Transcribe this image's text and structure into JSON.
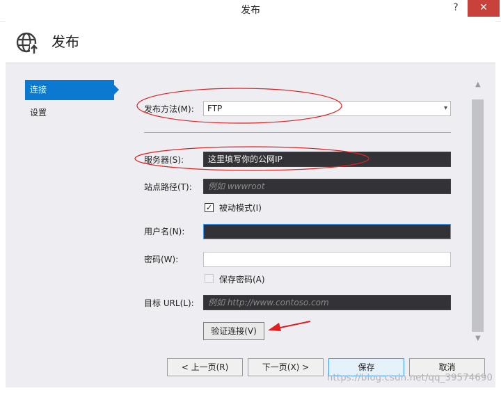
{
  "window": {
    "title": "发布",
    "help_glyph": "?",
    "close_glyph": "✕"
  },
  "header": {
    "title": "发布",
    "icon": "globe-publish-icon"
  },
  "nav": {
    "items": [
      {
        "label": "连接",
        "active": true
      },
      {
        "label": "设置",
        "active": false
      }
    ]
  },
  "form": {
    "method": {
      "label": "发布方法(M):",
      "value": "FTP"
    },
    "server": {
      "label": "服务器(S):",
      "value": "这里填写你的公网IP"
    },
    "site_path": {
      "label": "站点路径(T):",
      "placeholder": "例如 wwwroot"
    },
    "passive": {
      "label": "被动模式(I)",
      "checked": true
    },
    "username": {
      "label": "用户名(N):",
      "value": ""
    },
    "password": {
      "label": "密码(W):",
      "value": ""
    },
    "save_password": {
      "label": "保存密码(A)",
      "checked": false
    },
    "target_url": {
      "label": "目标 URL(L):",
      "placeholder": "例如 http://www.contoso.com"
    },
    "verify_button": "验证连接(V)"
  },
  "buttons": {
    "prev": "< 上一页(R)",
    "next": "下一页(X) >",
    "save": "保存",
    "cancel": "取消"
  },
  "watermark": "https://blog.csdn.net/qq_39574690",
  "colors": {
    "accent": "#0b79d0",
    "annotation": "#e02020",
    "dark_field": "#333337",
    "close": "#c8413a"
  }
}
